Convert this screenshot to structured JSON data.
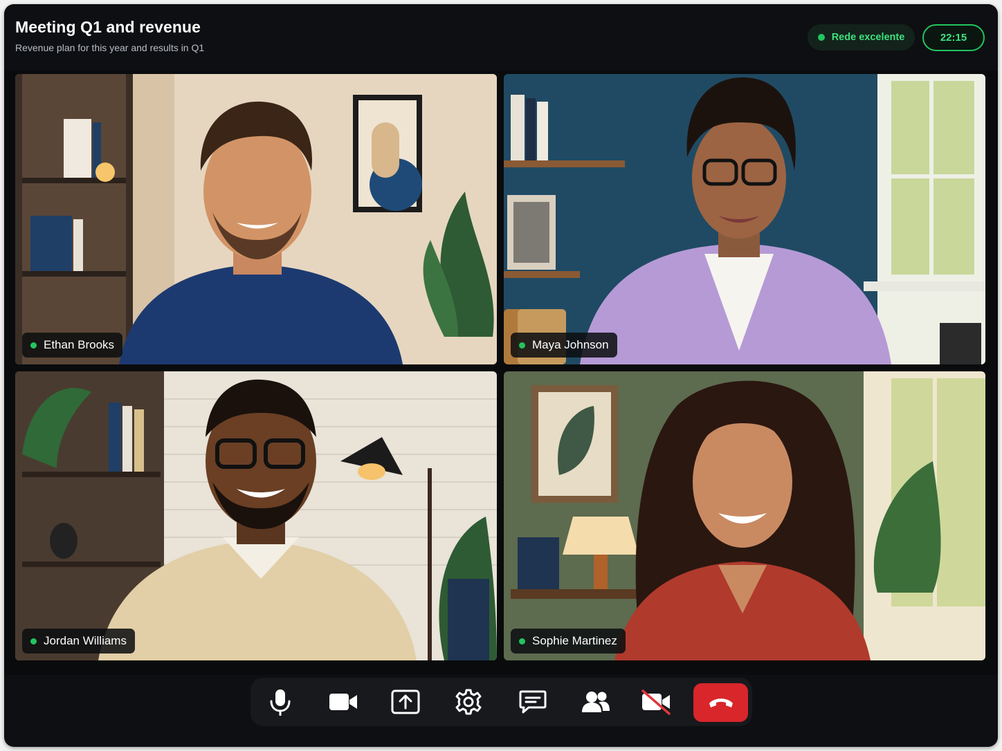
{
  "meeting": {
    "title": "Meeting Q1 and revenue",
    "subtitle": "Revenue plan for this year and results in Q1"
  },
  "status": {
    "network_label": "Rede excelente",
    "timer": "22:15",
    "accent_color": "#22c55e"
  },
  "participants": [
    {
      "name": "Ethan Brooks",
      "status": "online"
    },
    {
      "name": "Maya Johnson",
      "status": "online"
    },
    {
      "name": "Jordan Williams",
      "status": "online"
    },
    {
      "name": "Sophie Martinez",
      "status": "online"
    }
  ],
  "toolbar": {
    "buttons": [
      {
        "icon": "microphone-icon"
      },
      {
        "icon": "camera-icon"
      },
      {
        "icon": "share-screen-icon"
      },
      {
        "icon": "gear-icon"
      },
      {
        "icon": "chat-icon"
      },
      {
        "icon": "people-icon"
      },
      {
        "icon": "camera-off-icon"
      },
      {
        "icon": "end-call-icon",
        "color": "#d8262b"
      }
    ]
  }
}
